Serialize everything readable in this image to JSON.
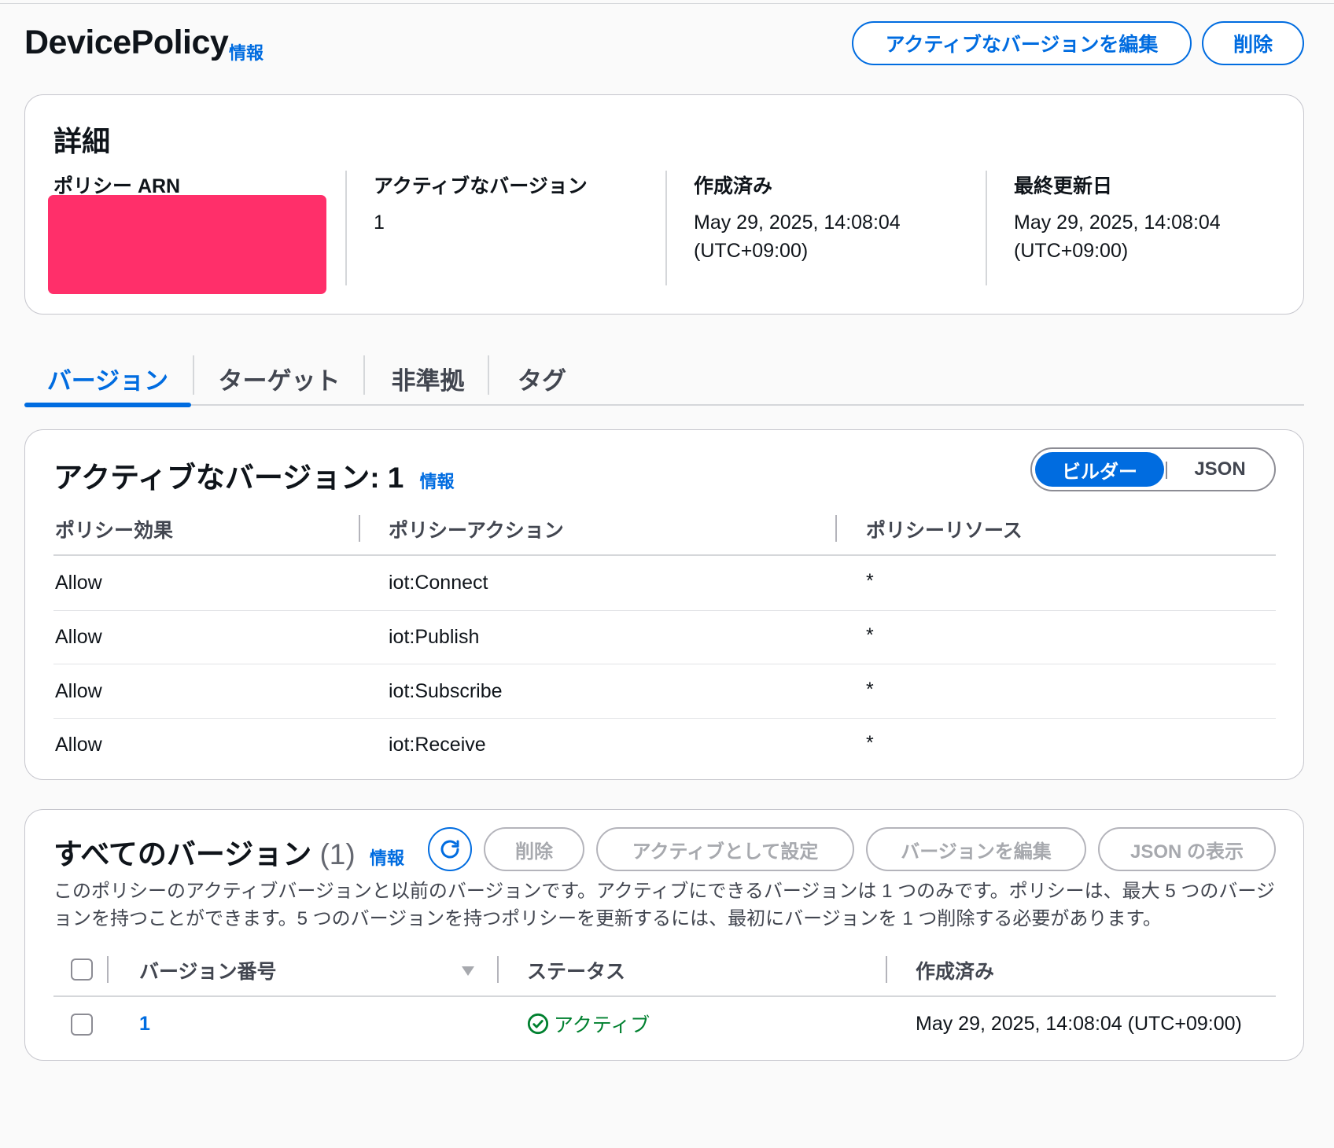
{
  "header": {
    "title": "DevicePolicy",
    "info": "情報",
    "edit_active_label": "アクティブなバージョンを編集",
    "delete_label": "削除"
  },
  "details": {
    "heading": "詳細",
    "arn_label": "ポリシー ARN",
    "active_version_label": "アクティブなバージョン",
    "active_version_value": "1",
    "created_label": "作成済み",
    "created_value_line1": "May 29, 2025, 14:08:04",
    "created_value_line2": "(UTC+09:00)",
    "updated_label": "最終更新日",
    "updated_value_line1": "May 29, 2025, 14:08:04",
    "updated_value_line2": "(UTC+09:00)"
  },
  "tabs": [
    {
      "label": "バージョン",
      "active": true
    },
    {
      "label": "ターゲット",
      "active": false
    },
    {
      "label": "非準拠",
      "active": false
    },
    {
      "label": "タグ",
      "active": false
    }
  ],
  "active_version": {
    "heading": "アクティブなバージョン: 1",
    "info": "情報",
    "toggle": {
      "builder": "ビルダー",
      "json": "JSON",
      "selected": "ビルダー"
    },
    "columns": [
      "ポリシー効果",
      "ポリシーアクション",
      "ポリシーリソース"
    ],
    "rows": [
      {
        "effect": "Allow",
        "action": "iot:Connect",
        "resource": "*"
      },
      {
        "effect": "Allow",
        "action": "iot:Publish",
        "resource": "*"
      },
      {
        "effect": "Allow",
        "action": "iot:Subscribe",
        "resource": "*"
      },
      {
        "effect": "Allow",
        "action": "iot:Receive",
        "resource": "*"
      }
    ]
  },
  "all_versions": {
    "heading": "すべてのバージョン",
    "count": "(1)",
    "info": "情報",
    "buttons": {
      "delete": "削除",
      "set_active": "アクティブとして設定",
      "edit_version": "バージョンを編集",
      "view_json": "JSON の表示"
    },
    "description": "このポリシーのアクティブバージョンと以前のバージョンです。アクティブにできるバージョンは 1 つのみです。ポリシーは、最大 5 つのバージョンを持つことができます。5 つのバージョンを持つポリシーを更新するには、最初にバージョンを 1 つ削除する必要があります。",
    "columns": [
      "バージョン番号",
      "ステータス",
      "作成済み"
    ],
    "rows": [
      {
        "version": "1",
        "status": "アクティブ",
        "created": "May 29, 2025, 14:08:04 (UTC+09:00)"
      }
    ]
  },
  "colors": {
    "accent": "#006ce0",
    "success": "#00802f",
    "redaction": "#ff2f6a"
  }
}
